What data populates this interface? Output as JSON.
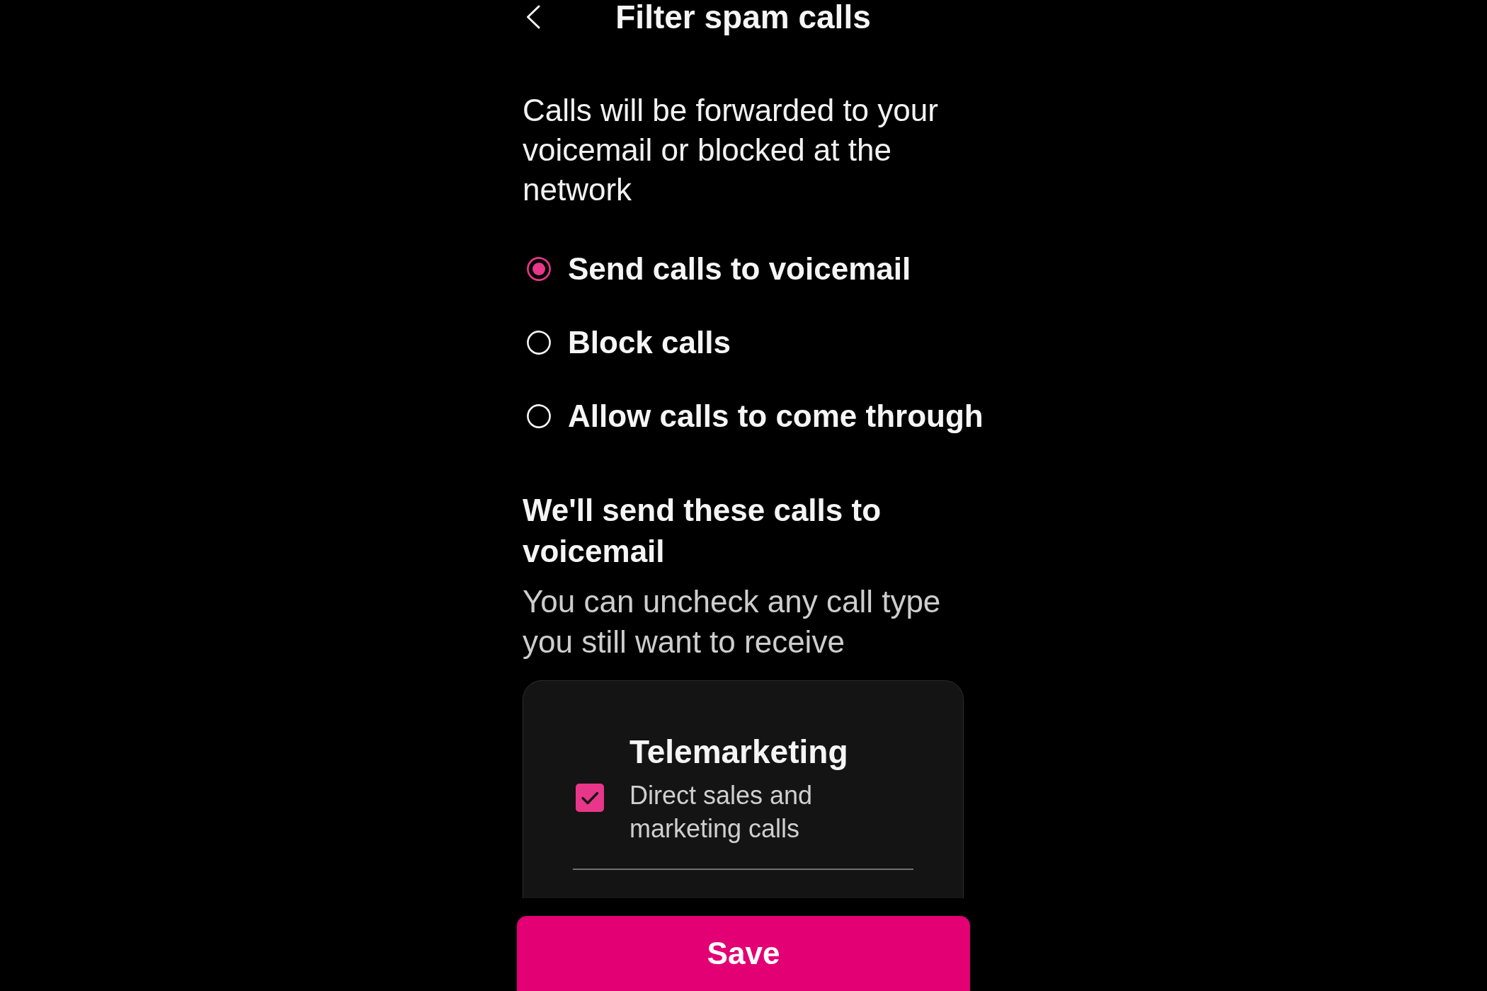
{
  "header": {
    "title": "Filter spam calls"
  },
  "description": "Calls will be forwarded to your voicemail or blocked at the network",
  "options": [
    {
      "label": "Send calls to voicemail",
      "selected": true
    },
    {
      "label": "Block calls",
      "selected": false
    },
    {
      "label": "Allow calls to come through",
      "selected": false
    }
  ],
  "call_types_section": {
    "heading": "We'll send these calls to voicemail",
    "subtitle": "You can uncheck any call type you still want to receive",
    "items": [
      {
        "title": "Telemarketing",
        "description": "Direct sales and marketing calls",
        "checked": true
      }
    ]
  },
  "save_button": {
    "label": "Save"
  }
}
